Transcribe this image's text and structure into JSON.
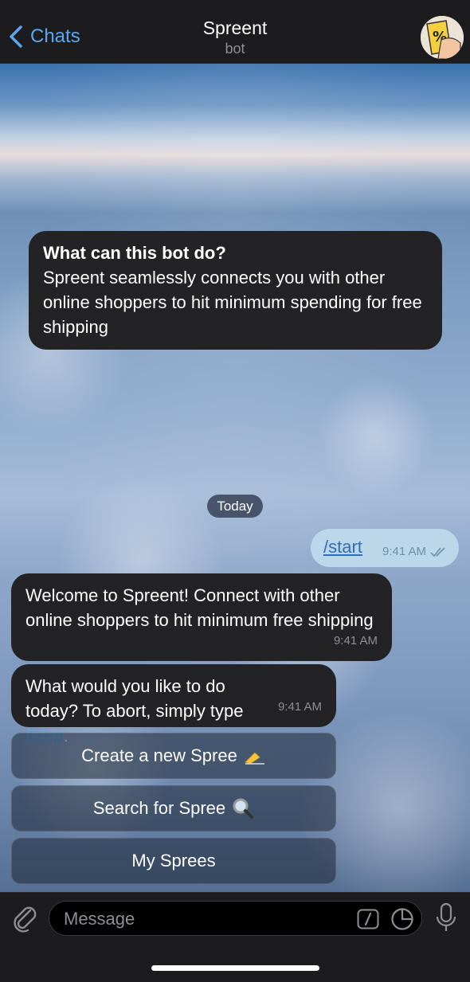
{
  "header": {
    "back_label": "Chats",
    "title": "Spreent",
    "subtitle": "bot"
  },
  "intro": {
    "title": "What can this bot do?",
    "body": "Spreent seamlessly connects you with other online shoppers to hit minimum spending for free shipping"
  },
  "date_separator": "Today",
  "outgoing": {
    "command": "/start",
    "time": "9:41 AM"
  },
  "messages": [
    {
      "text": "Welcome to Spreent! Connect with other online shoppers to hit minimum free shipping",
      "time": "9:41 AM"
    },
    {
      "text_before": "What would you like to do today? To abort, simply type ",
      "link": "/stop",
      "text_after": ".",
      "time": "9:41 AM"
    }
  ],
  "keyboard": [
    {
      "label": "Create a new Spree",
      "icon": "writing-hand-icon"
    },
    {
      "label": "Search for Spree",
      "icon": "magnifier-icon"
    },
    {
      "label": "My Sprees"
    }
  ],
  "input": {
    "placeholder": "Message"
  },
  "colors": {
    "accent": "#5aa7f0",
    "outgoing_bubble": "#bcd7ea",
    "incoming_bubble": "#232326"
  }
}
